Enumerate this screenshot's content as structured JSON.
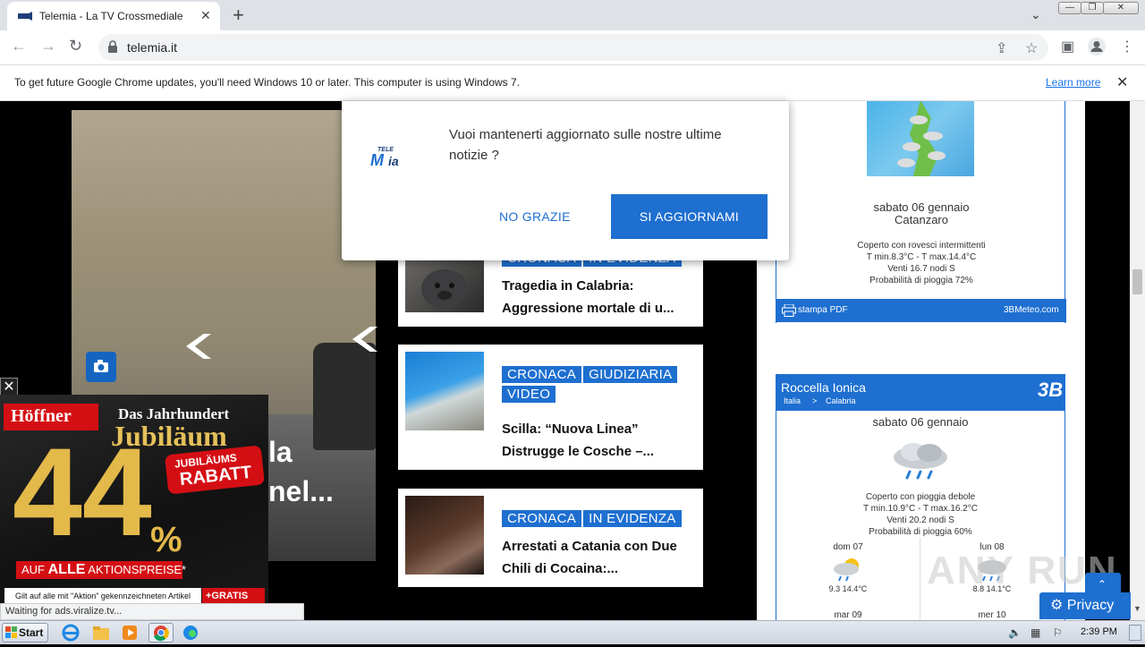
{
  "browser": {
    "tab_title": "Telemia - La TV Crossmediale",
    "tab_close": "✕",
    "new_tab": "+",
    "url": "telemia.it",
    "win_min": "—",
    "win_max": "❐",
    "win_close": "✕"
  },
  "infobar": {
    "message": "To get future Google Chrome updates, you'll need Windows 10 or later. This computer is using Windows 7.",
    "learn_more": "Learn more",
    "close": "✕"
  },
  "popup": {
    "message": "Vuoi mantenerti aggiornato sulle nostre ultime notizie ?",
    "no_label": "NO GRAZIE",
    "yes_label": "SI AGGIORNAMI",
    "logo_text": "TELE IA"
  },
  "hero": {
    "title_partial": "la\nnel..."
  },
  "articles": [
    {
      "tags": [
        "CRONACA",
        "IN EVIDENZA"
      ],
      "title": "Tragedia in Calabria: Aggressione mortale di u..."
    },
    {
      "tags": [
        "CRONACA",
        "GIUDIZIARIA",
        "VIDEO"
      ],
      "title": "Scilla: “Nuova Linea” Distrugge le Cosche –..."
    },
    {
      "tags": [
        "CRONACA",
        "IN EVIDENZA"
      ],
      "title": "Arrestati a Catania con Due Chili di Cocaina:..."
    }
  ],
  "weather_top": {
    "date": "sabato 06 gennaio",
    "city": "Catanzaro",
    "desc": "Coperto con rovesci intermittenti",
    "temps": "T min.8.3°C - T max.14.4°C",
    "wind": "Venti 16.7 nodi S",
    "rain": "Probabilità di pioggia 72%",
    "print": "stampa PDF",
    "source": "3BMeteo.com"
  },
  "weather_bottom": {
    "city": "Roccella Ionica",
    "breadcrumb_a": "Italia",
    "breadcrumb_sep": ">",
    "breadcrumb_b": "Calabria",
    "logo": "3B",
    "date": "sabato 06 gennaio",
    "desc": "Coperto con pioggia debole",
    "temps": "T min.10.9°C - T max.16.2°C",
    "wind": "Venti 20.2 nodi S",
    "rain": "Probabilità di pioggia 60%",
    "days": [
      {
        "label": "dom 07",
        "temps": "9.3 14.4°C"
      },
      {
        "label": "lun 08",
        "temps": "8.8 14.1°C"
      },
      {
        "label": "mar 09",
        "temps": ""
      },
      {
        "label": "mer 10",
        "temps": ""
      }
    ]
  },
  "ad": {
    "brand": "Höffner",
    "headline_a": "Das Jahrhundert",
    "headline_b": "Jubiläum",
    "big_number": "44",
    "percent": "%",
    "sticker_a": "JUBILÄUMS",
    "sticker_b": "RABATT",
    "ribbon_a": "AUF ",
    "ribbon_b": "ALLE",
    "ribbon_c": " AKTIONSPREISE*",
    "footer": "Gilt auf alle mit \"Aktion\" gekennzeichneten Artikel",
    "gratis": "+GRATIS"
  },
  "status_text": "Waiting for ads.viralize.tv...",
  "privacy_label": "Privacy",
  "taskbar": {
    "start": "Start",
    "clock": "2:39 PM"
  },
  "watermark": "ANY RUN"
}
